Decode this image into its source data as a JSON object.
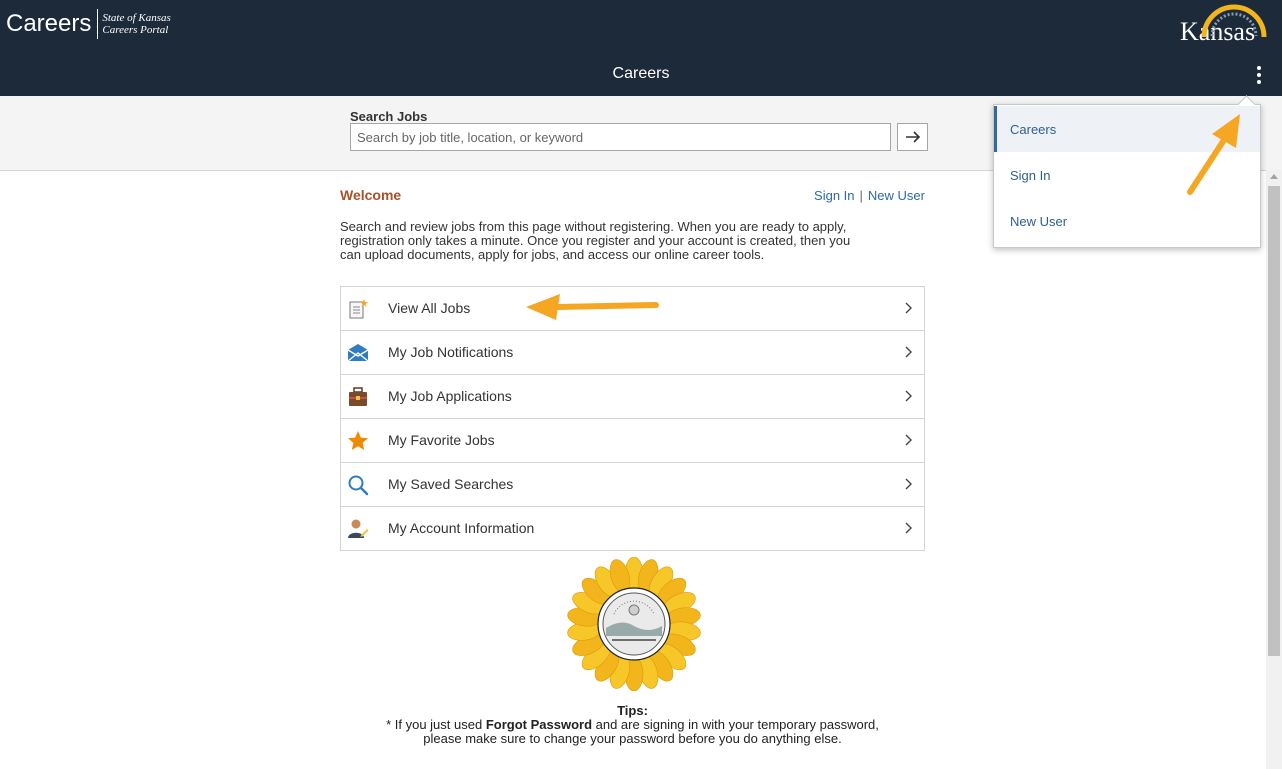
{
  "header": {
    "brand_title": "Careers",
    "brand_sub_line1": "State of Kansas",
    "brand_sub_line2": "Careers Portal",
    "logo_text": "Kansas",
    "page_title": "Careers"
  },
  "search": {
    "label": "Search Jobs",
    "placeholder": "Search by job title, location, or keyword",
    "value": ""
  },
  "welcome": {
    "title": "Welcome",
    "sign_in": "Sign In",
    "separator": "|",
    "new_user": "New User",
    "intro_line1": "Search and review jobs from this page without registering. When you are ready to apply,",
    "intro_line2": "registration only takes a minute. Once you register and your account is created, then you",
    "intro_line3": "can upload documents, apply for jobs, and access our online career tools."
  },
  "menu": {
    "items": [
      {
        "label": "View All Jobs",
        "icon": "document-new-icon"
      },
      {
        "label": "My Job Notifications",
        "icon": "envelope-icon"
      },
      {
        "label": "My Job Applications",
        "icon": "briefcase-icon"
      },
      {
        "label": "My Favorite Jobs",
        "icon": "star-icon"
      },
      {
        "label": "My Saved Searches",
        "icon": "magnifier-icon"
      },
      {
        "label": "My Account Information",
        "icon": "user-edit-icon"
      }
    ]
  },
  "tips": {
    "title": "Tips:",
    "line1_prefix": "* If you just used ",
    "line1_bold": "Forgot Password",
    "line1_suffix": " and are signing in with your temporary password,",
    "line2": "please make sure to change your password before you do anything else."
  },
  "dropdown": {
    "items": [
      {
        "label": "Careers",
        "active": true
      },
      {
        "label": "Sign In",
        "active": false
      },
      {
        "label": "New User",
        "active": false
      }
    ]
  },
  "colors": {
    "banner": "#1c2a3a",
    "welcome_accent": "#a6522a",
    "link": "#2f6aa3",
    "annotation_arrow": "#f5a623"
  }
}
